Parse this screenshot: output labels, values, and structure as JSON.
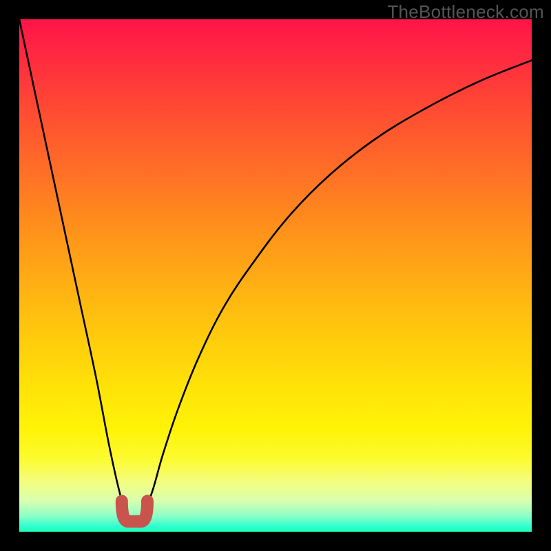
{
  "attribution": "TheBottleneck.com",
  "colors": {
    "top": "#ff1448",
    "bottom": "#1fffb6",
    "curve": "#000000",
    "bump": "#c9544e",
    "frame": "#000000"
  },
  "chart_data": {
    "type": "line",
    "title": "",
    "xlabel": "",
    "ylabel": "",
    "xlim": [
      0,
      1
    ],
    "ylim": [
      0,
      1
    ],
    "series": [
      {
        "name": "bottleneck-curve",
        "x": [
          0.0,
          0.03,
          0.06,
          0.09,
          0.12,
          0.15,
          0.175,
          0.195,
          0.21,
          0.225,
          0.24,
          0.26,
          0.28,
          0.31,
          0.35,
          0.4,
          0.46,
          0.53,
          0.61,
          0.7,
          0.8,
          0.9,
          1.0
        ],
        "y": [
          1.0,
          0.86,
          0.72,
          0.58,
          0.44,
          0.3,
          0.17,
          0.08,
          0.03,
          0.02,
          0.03,
          0.08,
          0.15,
          0.24,
          0.34,
          0.44,
          0.53,
          0.62,
          0.7,
          0.77,
          0.83,
          0.88,
          0.92
        ]
      }
    ],
    "annotations": [
      {
        "name": "optimal-bump",
        "shape": "u",
        "x_range": [
          0.2,
          0.25
        ],
        "y_bottom": 0.02,
        "y_top": 0.06
      }
    ]
  }
}
